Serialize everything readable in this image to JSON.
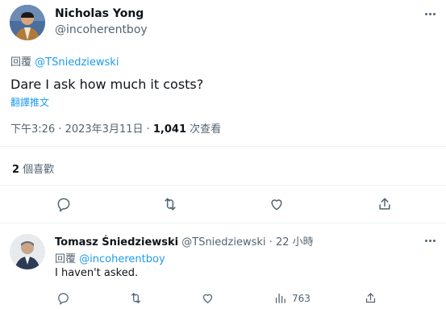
{
  "main_tweet": {
    "author_name": "Nicholas Yong",
    "author_handle": "@incoherentboy",
    "reply_prefix": "回覆",
    "reply_to": "@TSniedziewski",
    "text": "Dare I ask how much it costs?",
    "translate_label": "翻譯推文",
    "timestamp": "下午3:26 · 2023年3月11日 · ",
    "views_count": "1,041",
    "views_label": " 次查看",
    "likes_count": "2",
    "likes_label": " 個喜歡"
  },
  "reply_tweet": {
    "author_name": "Tomasz Śniedziewski",
    "author_handle": "@TSniedziewski",
    "separator": " · ",
    "time_ago": "22 小時",
    "reply_prefix": "回覆",
    "reply_to": "@incoherentboy",
    "text": "I haven't asked.",
    "views_count": "763"
  },
  "icons": {
    "reply": "reply-icon",
    "retweet": "retweet-icon",
    "like": "like-icon",
    "share": "share-icon",
    "views": "views-icon",
    "more": "more-icon"
  },
  "colors": {
    "accent": "#1d9bf0",
    "muted": "#536471",
    "text": "#0f1419",
    "divider": "#eff3f4"
  }
}
